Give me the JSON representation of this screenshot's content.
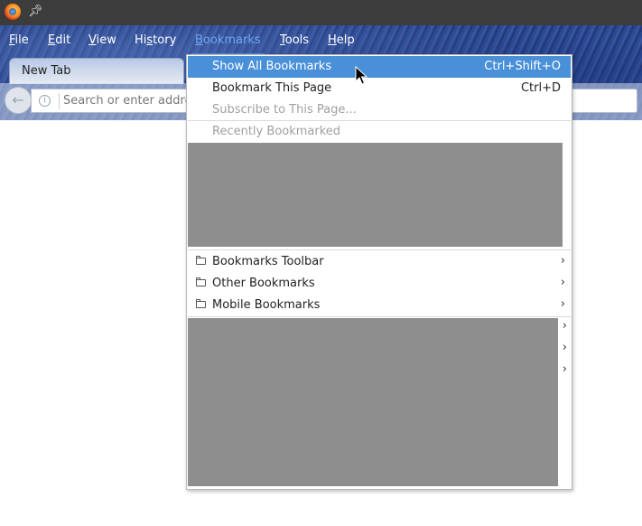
{
  "titlebar": {
    "icons": [
      "firefox-logo-icon",
      "pin-icon"
    ]
  },
  "menubar": {
    "items": [
      {
        "label": "File",
        "accel": "F",
        "rest": "ile"
      },
      {
        "label": "Edit",
        "accel": "E",
        "rest": "dit"
      },
      {
        "label": "View",
        "accel": "V",
        "rest": "iew"
      },
      {
        "label": "History",
        "pre": "Hi",
        "accel": "s",
        "rest": "tory"
      },
      {
        "label": "Bookmarks",
        "accel": "B",
        "rest": "ookmarks",
        "active": true
      },
      {
        "label": "Tools",
        "accel": "T",
        "rest": "ools"
      },
      {
        "label": "Help",
        "accel": "H",
        "rest": "elp"
      }
    ]
  },
  "tabs": [
    {
      "title": "New Tab"
    }
  ],
  "navbar": {
    "back_icon": "back-arrow-icon",
    "info_icon": "info-icon",
    "url_placeholder": "Search or enter address"
  },
  "bookmarks_menu": {
    "show_all": {
      "label": "Show All Bookmarks",
      "shortcut": "Ctrl+Shift+O"
    },
    "bookmark_page": {
      "label": "Bookmark This Page",
      "shortcut": "Ctrl+D"
    },
    "subscribe": {
      "label": "Subscribe to This Page..."
    },
    "recently_bookmarked": {
      "label": "Recently Bookmarked"
    },
    "folders": [
      {
        "label": "Bookmarks Toolbar",
        "icon": "folder-icon"
      },
      {
        "label": "Other Bookmarks",
        "icon": "folder-icon"
      },
      {
        "label": "Mobile Bookmarks",
        "icon": "folder-icon"
      }
    ],
    "submenu_icon": "chevron-right-icon"
  },
  "colors": {
    "highlight": "#4a90d9",
    "active_menu": "#6fa5f0",
    "disabled_text": "#a0a0a0",
    "redacted_block": "#8e8e8e"
  }
}
